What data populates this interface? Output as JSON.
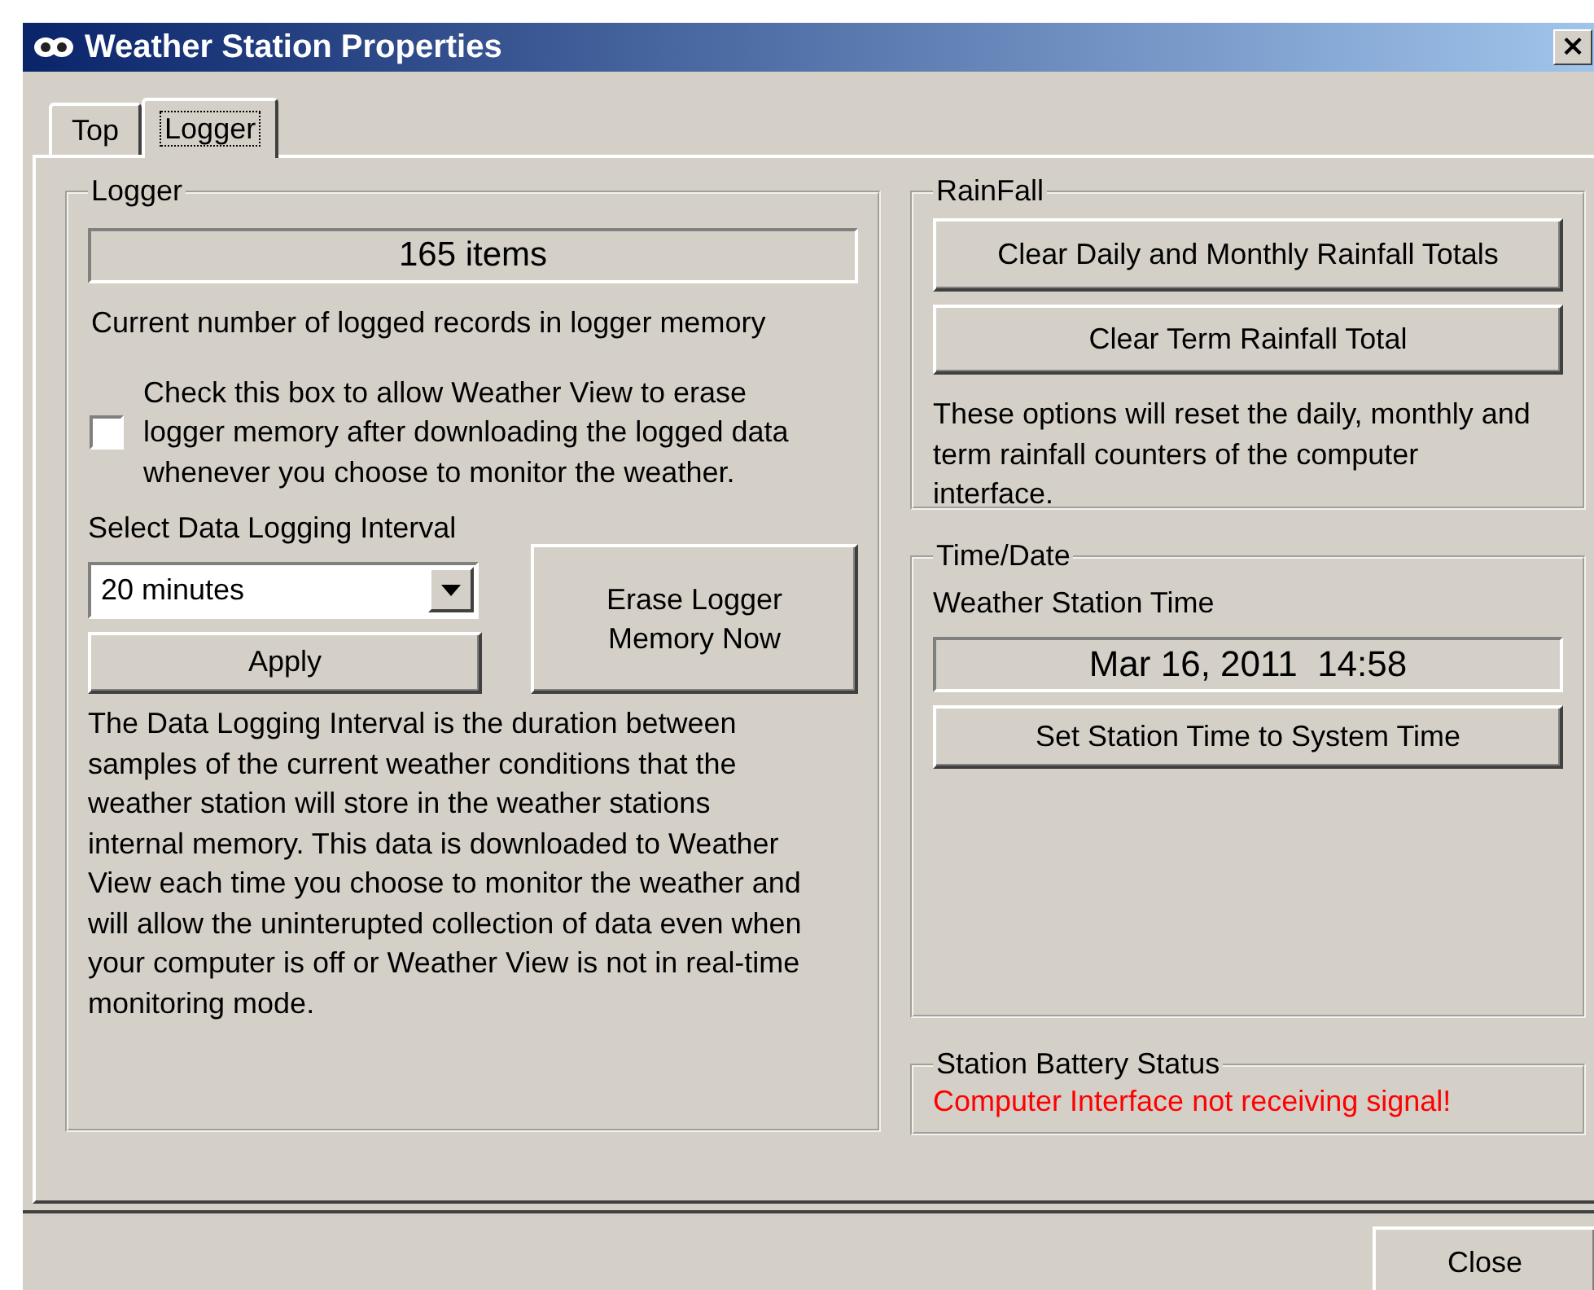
{
  "window": {
    "title": "Weather Station Properties",
    "close": "×"
  },
  "tabs": [
    {
      "label": "Top",
      "selected": false
    },
    {
      "label": "Logger",
      "selected": true
    }
  ],
  "logger": {
    "title": "Logger",
    "count": "165 items",
    "count_caption": "Current number of logged records in logger memory",
    "erase_checkbox": {
      "label": "Check this box to allow Weather View to erase logger memory after downloading the logged data whenever you choose to monitor the weather.",
      "checked": false
    },
    "interval_label": "Select Data Logging Interval",
    "interval_select": {
      "value": "20 minutes"
    },
    "apply_button": "Apply",
    "erase_button": "Erase Logger Memory Now",
    "description": "The Data Logging Interval is the duration between samples of the current weather conditions that the weather station will store in the weather stations internal memory.  This data is downloaded to Weather View each time you choose to monitor the weather and will allow the uninterupted collection of data even when your computer is off or Weather View is not in real-time monitoring mode."
  },
  "rainfall": {
    "title": "RainFall",
    "buttons": [
      "Clear Daily and Monthly Rainfall Totals",
      "Clear Term Rainfall Total"
    ],
    "note": "These options will reset the daily, monthly and term rainfall counters of the computer interface."
  },
  "time_date": {
    "title": "Time/Date",
    "label": "Weather Station Time",
    "value": "Mar 16, 2011  14:58",
    "button": "Set Station Time to System Time"
  },
  "battery": {
    "title": "Station Battery Status",
    "status": "Computer Interface not receiving signal!",
    "color": "#ff0000"
  },
  "close_button": "Close"
}
